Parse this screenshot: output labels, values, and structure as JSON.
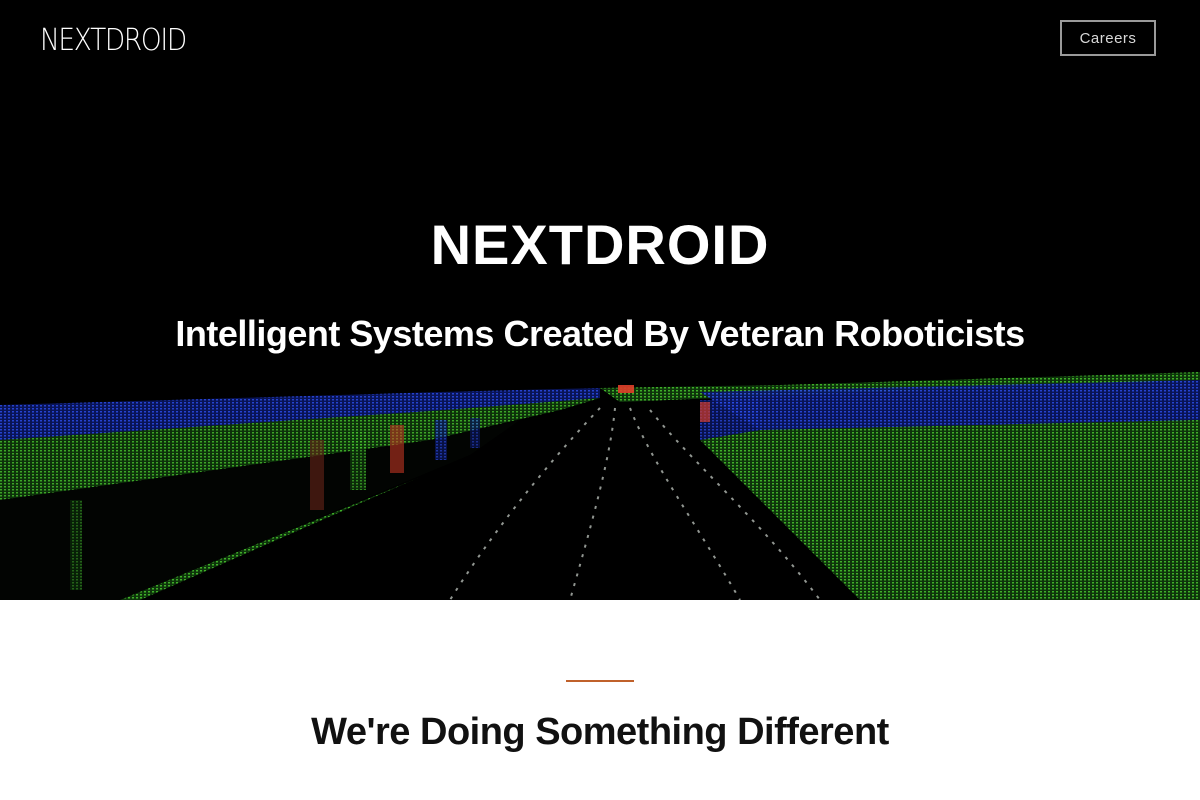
{
  "nav": {
    "logo_text": "NEXTDROID",
    "careers_label": "Careers"
  },
  "hero": {
    "title": "NEXTDROID",
    "subtitle": "Intelligent Systems Created By Veteran Roboticists",
    "background_image": "lidar-point-cloud-road",
    "colors": {
      "background": "#000000",
      "point_green": "#3fbf2a",
      "point_blue": "#1f3fd8",
      "point_red": "#e0402a"
    }
  },
  "section": {
    "heading": "We're Doing Something Different",
    "accent_color": "#c0612b"
  }
}
